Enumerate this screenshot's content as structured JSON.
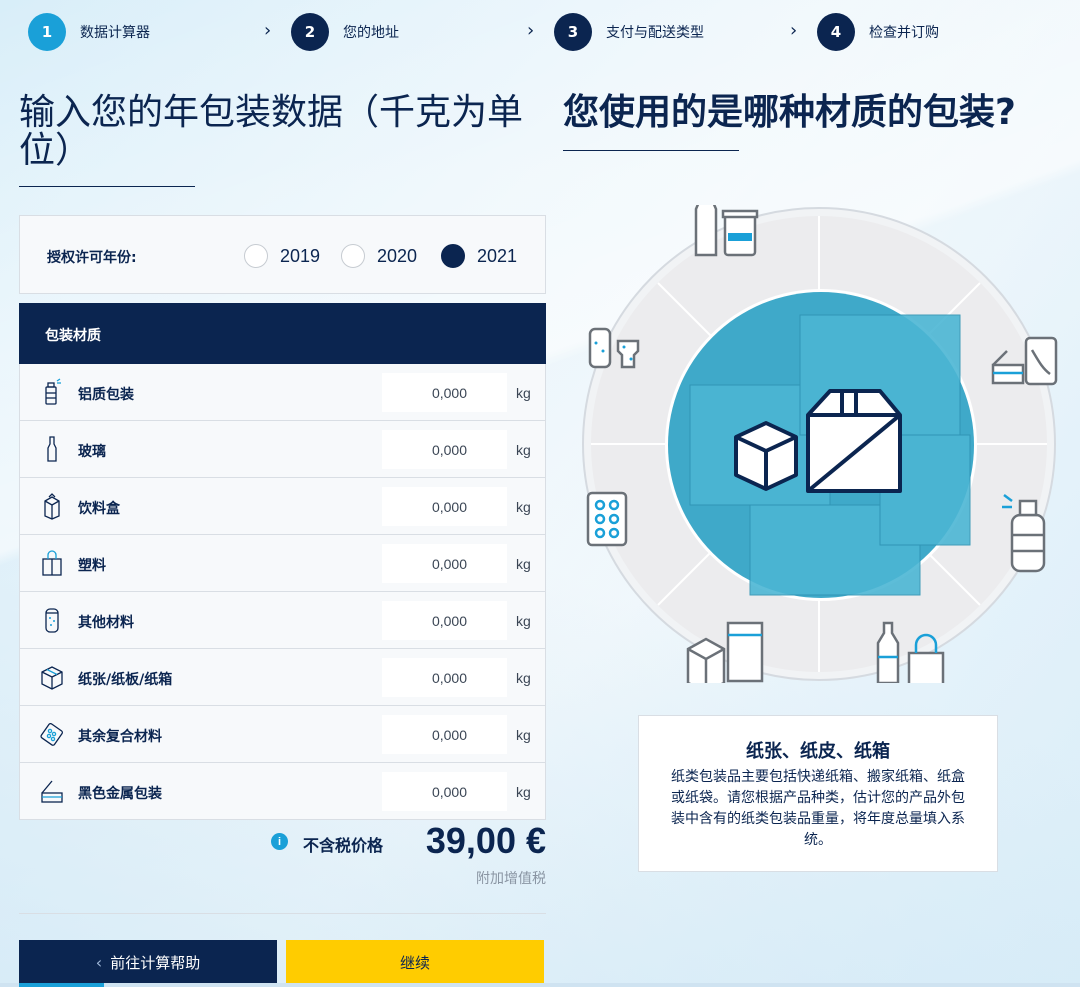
{
  "stepper": {
    "steps": [
      {
        "num": "1",
        "label": "数据计算器"
      },
      {
        "num": "2",
        "label": "您的地址"
      },
      {
        "num": "3",
        "label": "支付与配送类型"
      },
      {
        "num": "4",
        "label": "检查并订购"
      }
    ],
    "active_step": 1
  },
  "left": {
    "title": "输入您的年包装数据（千克为单位）",
    "license_year": {
      "label": "授权许可年份:",
      "options": [
        "2019",
        "2020",
        "2021"
      ],
      "selected": "2021"
    },
    "table": {
      "header": "包装材质",
      "unit": "kg",
      "rows": [
        {
          "icon": "spray-can-icon",
          "name": "铝质包装",
          "value": "0,000"
        },
        {
          "icon": "glass-bottle-icon",
          "name": "玻璃",
          "value": "0,000"
        },
        {
          "icon": "beverage-carton-icon",
          "name": "饮料盒",
          "value": "0,000"
        },
        {
          "icon": "plastic-bag-icon",
          "name": "塑料",
          "value": "0,000"
        },
        {
          "icon": "container-icon",
          "name": "其他材料",
          "value": "0,000"
        },
        {
          "icon": "cardboard-box-icon",
          "name": "纸张/纸板/纸箱",
          "value": "0,000"
        },
        {
          "icon": "blister-pack-icon",
          "name": "其余复合材料",
          "value": "0,000"
        },
        {
          "icon": "tin-can-icon",
          "name": "黑色金属包装",
          "value": "0,000"
        }
      ]
    },
    "price": {
      "info_icon": "info-icon",
      "label": "不含税价格",
      "value": "39,00 €",
      "vat_note": "附加增值税"
    },
    "buttons": {
      "back_label": "前往计算帮助",
      "continue_label": "继续"
    }
  },
  "right": {
    "title": "您使用的是哪种材质的包装?",
    "info_card": {
      "title": "纸张、纸皮、纸箱",
      "description": "纸类包装品主要包括快递纸箱、搬家纸箱、纸盒或纸袋。请您根据产品种类，估计您的产品外包装中含有的纸类包装品重量，将年度总量填入系统。"
    }
  },
  "colors": {
    "navy": "#0b2550",
    "accent_blue": "#1aa0d8",
    "yellow": "#ffcc00",
    "wheel_center": "#3fa9c9"
  }
}
